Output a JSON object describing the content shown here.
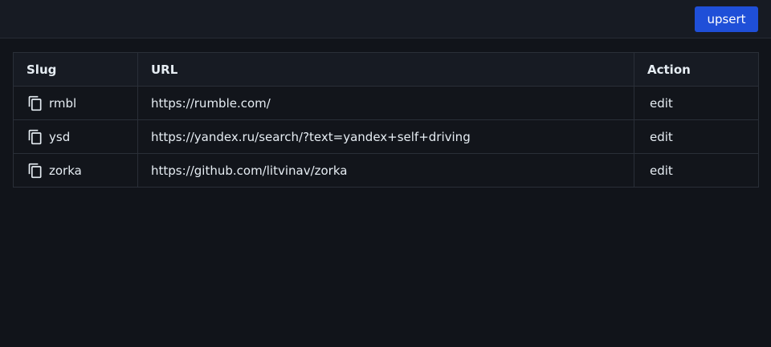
{
  "header": {
    "upsert_label": "upsert"
  },
  "table": {
    "columns": [
      "Slug",
      "URL",
      "Action"
    ],
    "rows": [
      {
        "slug": "rmbl",
        "url": "https://rumble.com/",
        "action": "edit"
      },
      {
        "slug": "ysd",
        "url": "https://yandex.ru/search/?text=yandex+self+driving",
        "action": "edit"
      },
      {
        "slug": "zorka",
        "url": "https://github.com/litvinav/zorka",
        "action": "edit"
      }
    ]
  },
  "colors": {
    "background": "#11141a",
    "header_bg": "#171b23",
    "accent": "#1f4fd8",
    "border": "#2a2f38",
    "text": "#e6edf3"
  },
  "icons": {
    "copy": "copy-icon"
  }
}
